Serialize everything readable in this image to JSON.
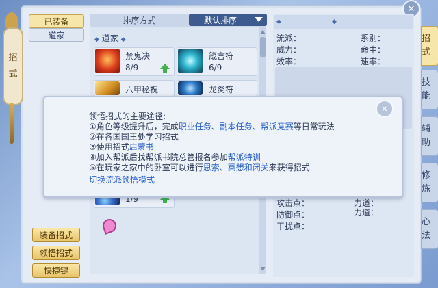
{
  "left_tag": {
    "label_1": "招",
    "label_2": "式"
  },
  "categories": {
    "equipped": "已装备",
    "daojia": "道家"
  },
  "sort": {
    "label": "排序方式",
    "selected": "默认排序"
  },
  "group_header": "道家",
  "skills": [
    {
      "name": "禁鬼决",
      "level": "8/9",
      "upgradable": true
    },
    {
      "name": "箴言符",
      "level": "6/9",
      "upgradable": false
    },
    {
      "name": "六甲秘祝",
      "level": "",
      "upgradable": false
    },
    {
      "name": "龙炎符",
      "level": "",
      "upgradable": false
    },
    {
      "name": "",
      "level": "1/9",
      "upgradable": true
    }
  ],
  "actions": {
    "equip": "装备招式",
    "learn": "领悟招式",
    "hotkey": "快捷键"
  },
  "details": {
    "school": "流派：",
    "category": "系别：",
    "power": "威力：",
    "hit": "命中：",
    "efficiency": "效率：",
    "speed": "速率：",
    "attack": "攻击点：",
    "strength": "力道：",
    "defense": "防御点：",
    "force": "力道：",
    "interference": "干扰点："
  },
  "tabs": [
    "招式",
    "技能",
    "辅助",
    "修炼",
    "心法"
  ],
  "popup": {
    "title": "领悟招式的主要途径:",
    "line1_a": "①角色等级提升后，完成",
    "line1_b": "职业任务、副本任务、帮派竞赛",
    "line1_c": "等日常玩法",
    "line2": "②在各国国王处学习招式",
    "line3_a": "③使用招式",
    "line3_b": "启蒙书",
    "line4_a": "④加入帮派后找帮派书院总管报名参加",
    "line4_b": "帮派特训",
    "line5_a": "⑤在玩家之家中的卧室可以进行",
    "line5_b": "思索、冥想和闭关",
    "line5_c": "来获得招式",
    "link": "切换流派领悟模式"
  },
  "icons": {
    "close": "close-icon",
    "popup_close": "close-icon",
    "upgrade": "arrow-up-icon",
    "cursor": "pointer-cursor-icon"
  }
}
